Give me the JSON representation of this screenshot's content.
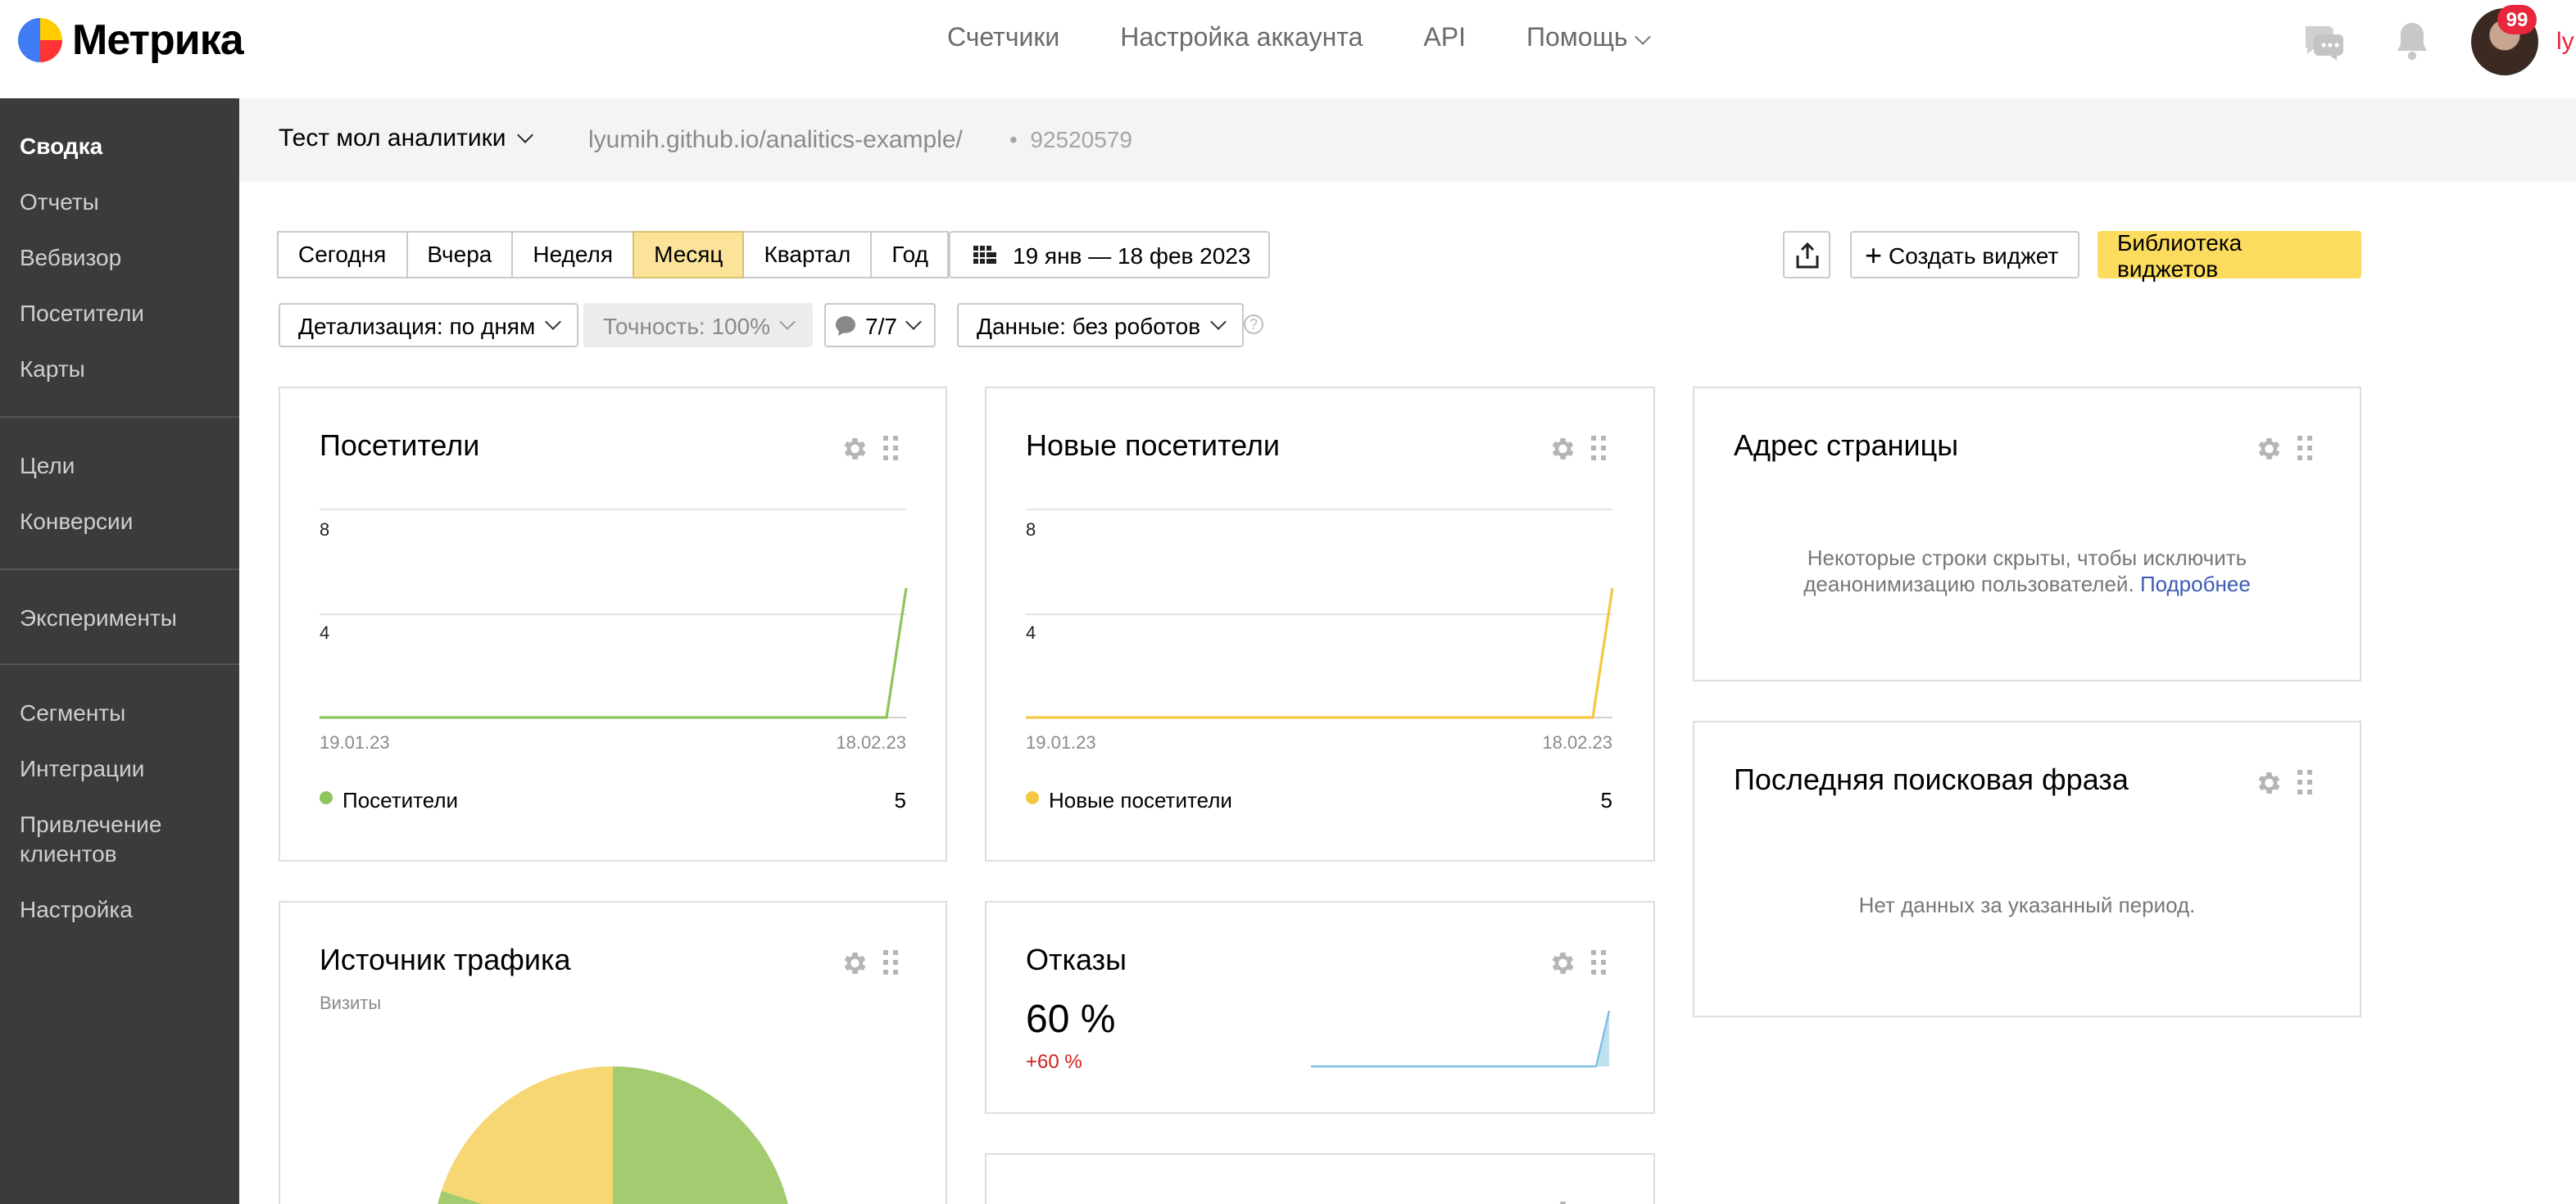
{
  "header": {
    "logo_text": "Метрика",
    "nav": [
      "Счетчики",
      "Настройка аккаунта",
      "API",
      "Помощь"
    ],
    "notifications_badge": "99",
    "user_initial_cut": "ly"
  },
  "sidebar": {
    "items": [
      "Сводка",
      "Отчеты",
      "Вебвизор",
      "Посетители",
      "Карты",
      "Цели",
      "Конверсии",
      "Эксперименты",
      "Сегменты",
      "Интеграции",
      "Привлечение клиентов",
      "Настройка"
    ],
    "active": "Сводка"
  },
  "project": {
    "name": "Тест мол аналитики",
    "url": "lyumih.github.io/analitics-example/",
    "id": "92520579",
    "id_separator": "•"
  },
  "toolbar": {
    "periods": [
      "Сегодня",
      "Вчера",
      "Неделя",
      "Месяц",
      "Квартал",
      "Год"
    ],
    "selected_period": "Месяц",
    "date_range": "19 янв — 18 фев 2023",
    "create_widget": "Создать виджет",
    "widget_library": "Библиотека виджетов",
    "detail": "Детализация: по дням",
    "accuracy": "Точность: 100%",
    "segments_count": "7/7",
    "data_filter": "Данные: без роботов",
    "help": "?"
  },
  "widgets": {
    "visitors": {
      "title": "Посетители",
      "legend": "Посетители",
      "total": "5",
      "x_start": "19.01.23",
      "x_end": "18.02.23",
      "y_ticks": [
        "8",
        "4"
      ]
    },
    "new_visitors": {
      "title": "Новые посетители",
      "legend": "Новые посетители",
      "total": "5",
      "x_start": "19.01.23",
      "x_end": "18.02.23",
      "y_ticks": [
        "8",
        "4"
      ]
    },
    "page_address": {
      "title": "Адрес страницы",
      "note_line1": "Некоторые строки скрыты, чтобы исключить",
      "note_line2": "деанонимизацию пользователей.",
      "note_link": "Подробнее"
    },
    "last_search": {
      "title": "Последняя поисковая фраза",
      "note": "Нет данных за указанный период."
    },
    "traffic": {
      "title": "Источник трафика",
      "subtitle": "Визиты"
    },
    "bounce": {
      "title": "Отказы",
      "value": "60 %",
      "delta": "+60 %"
    }
  },
  "colors": {
    "visitors": "#8dc45c",
    "new_visitors": "#f5c842",
    "bounce": "#7fc1e0",
    "pie_green": "#a3cb6f",
    "pie_yellow": "#f7d774",
    "accent_yellow": "#fbdc5e",
    "sidebar_bg": "#3b3b3b"
  },
  "chart_data": [
    {
      "type": "line",
      "title": "Посетители",
      "series": [
        {
          "name": "Посетители",
          "x": [
            "19.01.23",
            "17.02.23",
            "18.02.23"
          ],
          "values": [
            0,
            0,
            5
          ]
        }
      ],
      "ylim": [
        0,
        8
      ],
      "yticks": [
        4,
        8
      ]
    },
    {
      "type": "line",
      "title": "Новые посетители",
      "series": [
        {
          "name": "Новые посетители",
          "x": [
            "19.01.23",
            "17.02.23",
            "18.02.23"
          ],
          "values": [
            0,
            0,
            5
          ]
        }
      ],
      "ylim": [
        0,
        8
      ],
      "yticks": [
        4,
        8
      ]
    },
    {
      "type": "pie",
      "title": "Источник трафика",
      "slices": [
        {
          "color": "#a3cb6f",
          "value": 60
        },
        {
          "color": "#f7d774",
          "value": 40
        }
      ]
    }
  ]
}
